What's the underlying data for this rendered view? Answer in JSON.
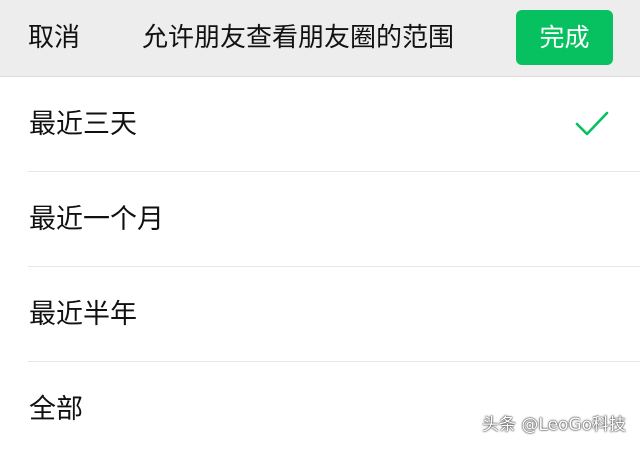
{
  "header": {
    "cancel_label": "取消",
    "title": "允许朋友查看朋友圈的范围",
    "done_label": "完成"
  },
  "options": [
    {
      "label": "最近三天",
      "selected": true
    },
    {
      "label": "最近一个月",
      "selected": false
    },
    {
      "label": "最近半年",
      "selected": false
    },
    {
      "label": "全部",
      "selected": false
    }
  ],
  "watermark": "头条 @LeoGo科技",
  "colors": {
    "accent": "#07c160",
    "header_bg": "#ededed",
    "check": "#07c160"
  },
  "icons": {
    "selected": "checkmark-icon"
  }
}
